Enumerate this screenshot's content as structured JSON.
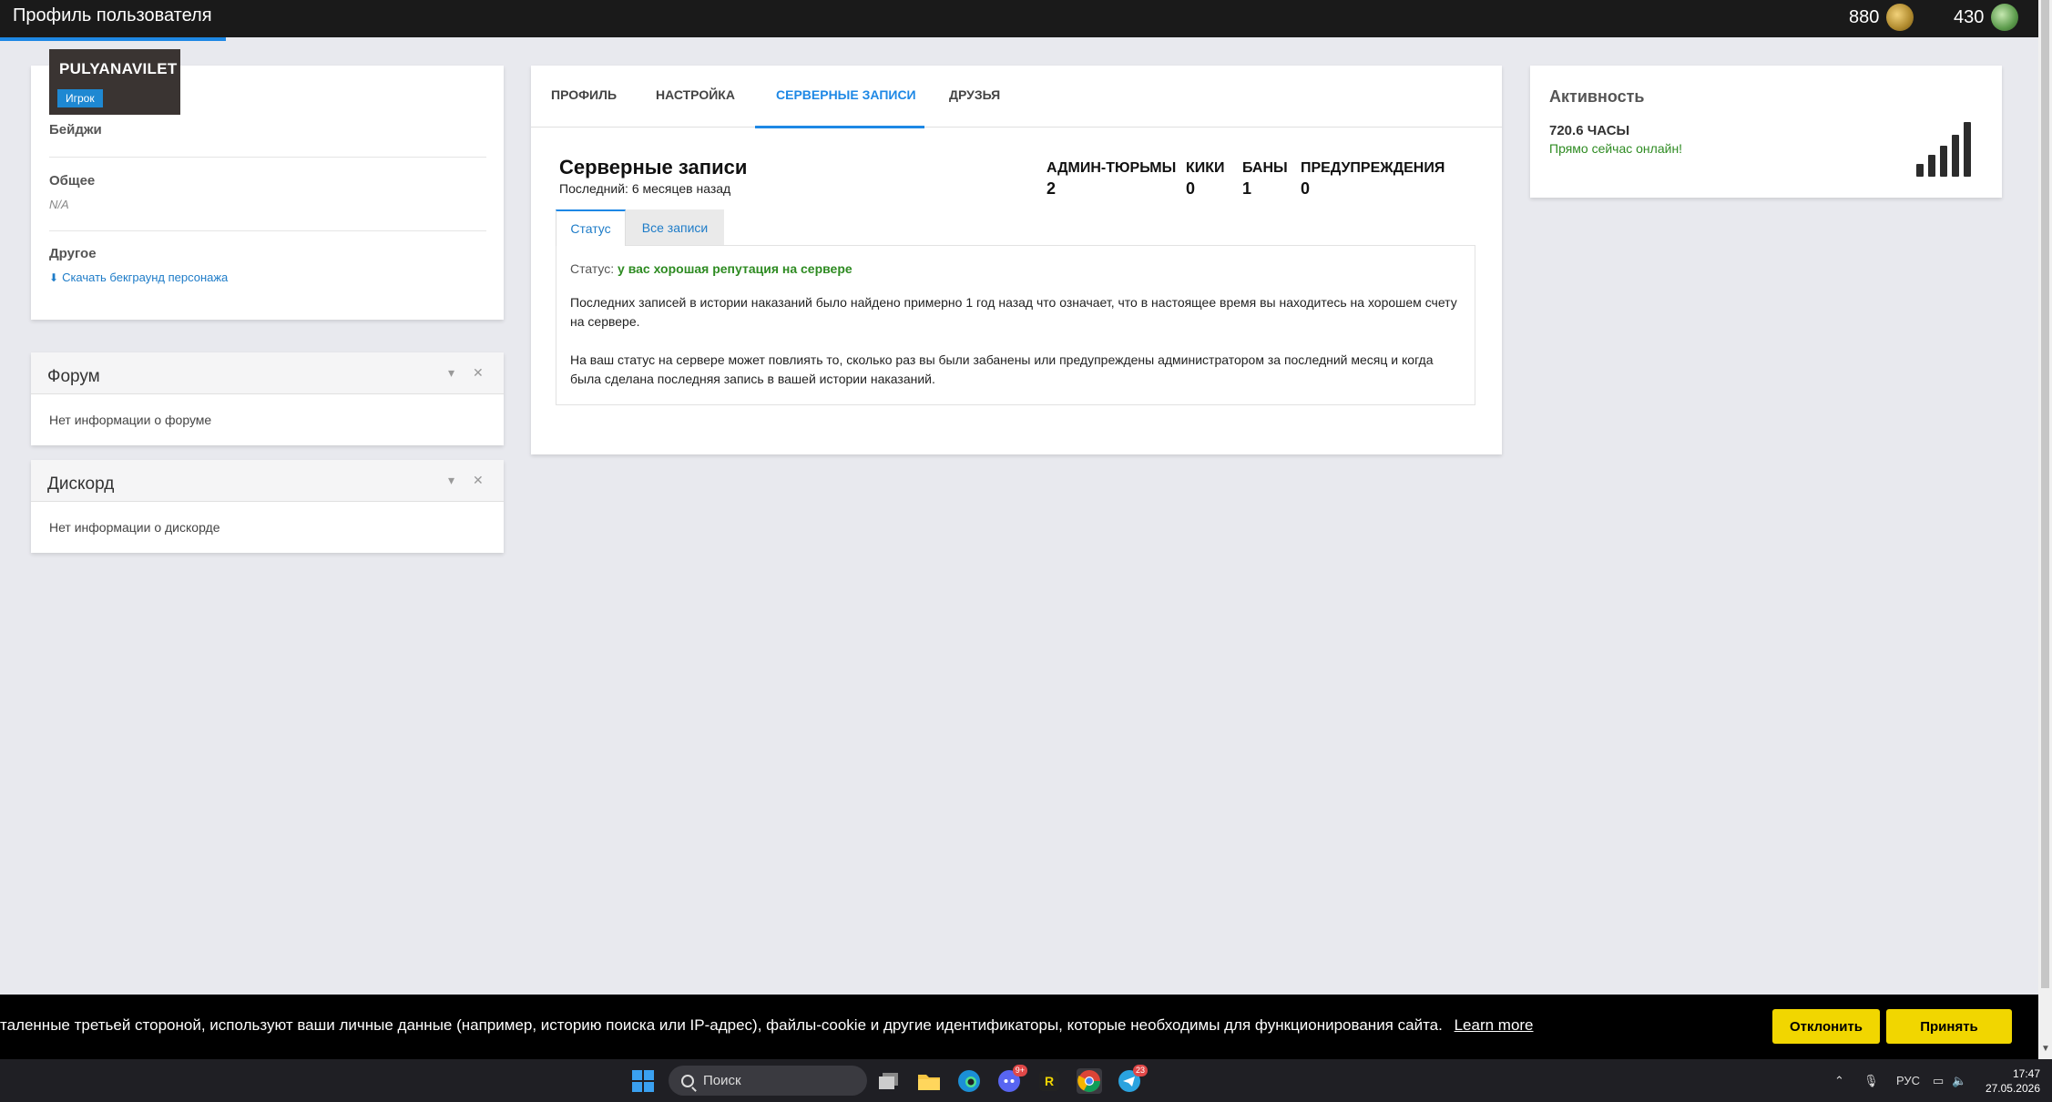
{
  "topbar": {
    "title": "Профиль пользователя",
    "currency_gold": "880",
    "currency_green": "430"
  },
  "profile": {
    "username": "PULYANAVILET",
    "role": "Игрок",
    "badges_label": "Бейджи",
    "general_label": "Общее",
    "general_value": "N/A",
    "other_label": "Другое",
    "download_link": "Скачать бекграунд персонажа"
  },
  "forum_widget": {
    "title": "Форум",
    "body": "Нет информации о форуме"
  },
  "discord_widget": {
    "title": "Дискорд",
    "body": "Нет информации о дискорде"
  },
  "main": {
    "tabs": [
      {
        "label": "ПРОФИЛЬ"
      },
      {
        "label": "НАСТРОЙКА"
      },
      {
        "label": "СЕРВЕРНЫЕ ЗАПИСИ"
      },
      {
        "label": "ДРУЗЬЯ"
      }
    ],
    "active_tab": "СЕРВЕРНЫЕ ЗАПИСИ",
    "records_title": "Серверные записи",
    "records_subtitle": "Последний: 6 месяцев назад",
    "stats": [
      {
        "label": "АДМИН-ТЮРЬМЫ",
        "value": "2"
      },
      {
        "label": "КИКИ",
        "value": "0"
      },
      {
        "label": "БАНЫ",
        "value": "1"
      },
      {
        "label": "ПРЕДУПРЕЖДЕНИЯ",
        "value": "0"
      }
    ],
    "subtabs": [
      {
        "label": "Статус"
      },
      {
        "label": "Все записи"
      }
    ],
    "status_prefix": "Статус:",
    "status_value": "у вас хорошая репутация на сервере",
    "paragraph1": "Последних записей в истории наказаний было найдено примерно 1 год назад что означает, что в настоящее время вы находитесь на хорошем счету на сервере.",
    "paragraph2": "На ваш статус на сервере может повлиять то, сколько раз вы были забанены или предупреждены администратором за последний месяц и когда была сделана последняя запись в вашей истории наказаний."
  },
  "activity": {
    "title": "Активность",
    "hours": "720.6 ЧАСЫ",
    "online": "Прямо сейчас онлайн!"
  },
  "cookie_banner": {
    "text": "таленные третьей стороной, используют ваши личные данные (например, историю поиска или IP-адрес), файлы-cookie и другие идентификаторы, которые необходимы для функционирования сайта.",
    "learn_more": "Learn more",
    "decline": "Отклонить",
    "accept": "Принять"
  },
  "taskbar": {
    "search_placeholder": "Поиск",
    "discord_badge": "9+",
    "telegram_badge": "23",
    "language": "РУС",
    "time": "17:47",
    "date": "27.05.2026"
  },
  "colors": {
    "accent": "#1e88e5",
    "good_status": "#2e8b22",
    "cookie_button": "#f1d600",
    "topbar": "#1a1a1a"
  }
}
